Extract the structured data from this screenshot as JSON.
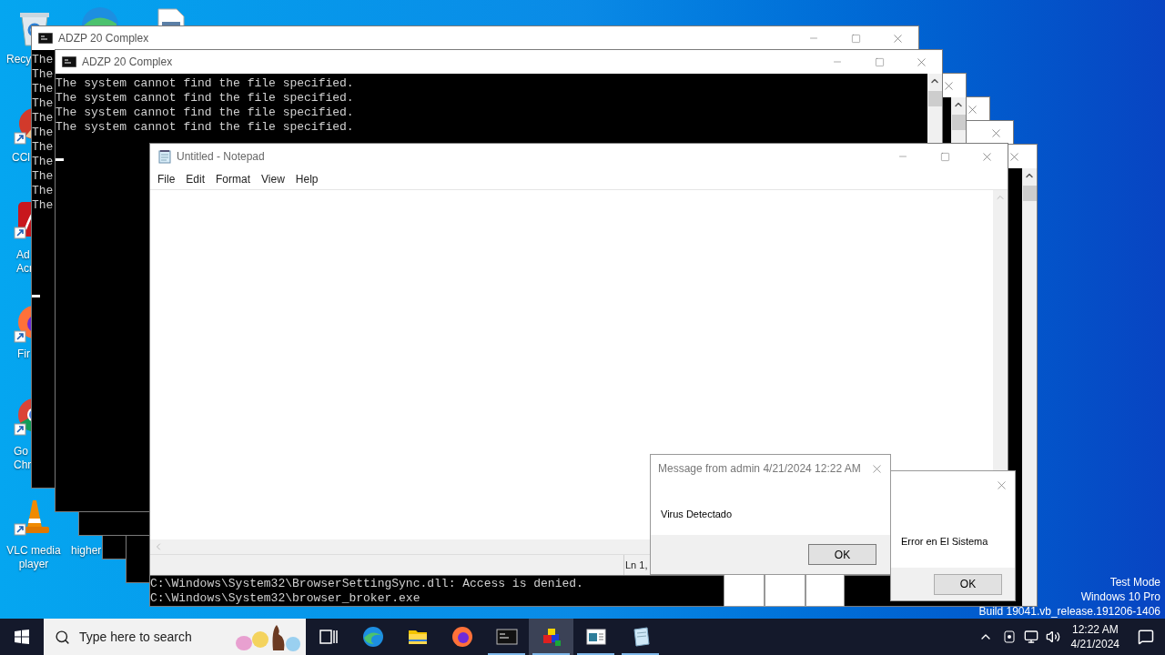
{
  "desktop_icons": [
    {
      "kind": "recycle-bin",
      "lines": [
        "Recy"
      ]
    },
    {
      "kind": "browser-wave"
    },
    {
      "kind": "document"
    },
    {
      "kind": "cleaner",
      "lines": [
        "CCl"
      ]
    },
    {
      "kind": "pdf",
      "lines": [
        "Ad",
        "Acr"
      ]
    },
    {
      "kind": "fox",
      "lines": [
        "Fir"
      ]
    },
    {
      "kind": "chrome",
      "lines": [
        "Go",
        "Chr"
      ]
    },
    {
      "kind": "cone",
      "lines": [
        "VLC media",
        "player"
      ]
    },
    {
      "lines": [
        "higher"
      ]
    }
  ],
  "consoles": [
    {
      "title": "ADZP 20 Complex",
      "lines": [
        "The",
        "The",
        "The",
        "The",
        "The",
        "The",
        "The",
        "The",
        "The",
        "The",
        "The"
      ],
      "cursor": true
    },
    {
      "title": "ADZP 20 Complex",
      "lines": [
        "The system cannot find the file specified.",
        "The system cannot find the file specified.",
        "The system cannot find the file specified.",
        "The system cannot find the file specified."
      ],
      "cursor": true
    },
    {
      "lines": [
        "C:\\Windows\\System32\\BrowserSettingSync.dll: Access is denied.",
        "C:\\Windows\\System32\\browser_broker.exe"
      ]
    }
  ],
  "notepad": {
    "title": "Untitled - Notepad",
    "menu": [
      "File",
      "Edit",
      "Format",
      "View",
      "Help"
    ],
    "status": "Ln 1,"
  },
  "message_box": {
    "title": "Message from admin 4/21/2024 12:22 AM",
    "message": "Virus Detectado",
    "button": "OK"
  },
  "error_box": {
    "message": "Error en El Sistema",
    "button": "OK"
  },
  "system_info": [
    "Test Mode",
    "Windows 10 Pro",
    "Build 19041.vb_release.191206-1406"
  ],
  "taskbar": {
    "search": {
      "placeholder": "Type here to search"
    },
    "apps": [
      {
        "kind": "task-view",
        "running": false,
        "selected": false
      },
      {
        "kind": "browser-wave",
        "running": false,
        "selected": false
      },
      {
        "kind": "folder",
        "running": false,
        "selected": false
      },
      {
        "kind": "fox",
        "running": false,
        "selected": false
      },
      {
        "kind": "console",
        "running": true,
        "selected": false
      },
      {
        "kind": "blocks",
        "running": true,
        "selected": true
      },
      {
        "kind": "window-app",
        "running": true,
        "selected": false
      },
      {
        "kind": "notepad",
        "running": true,
        "selected": false
      }
    ],
    "clock": {
      "time": "12:22 AM",
      "date": "4/21/2024"
    }
  }
}
